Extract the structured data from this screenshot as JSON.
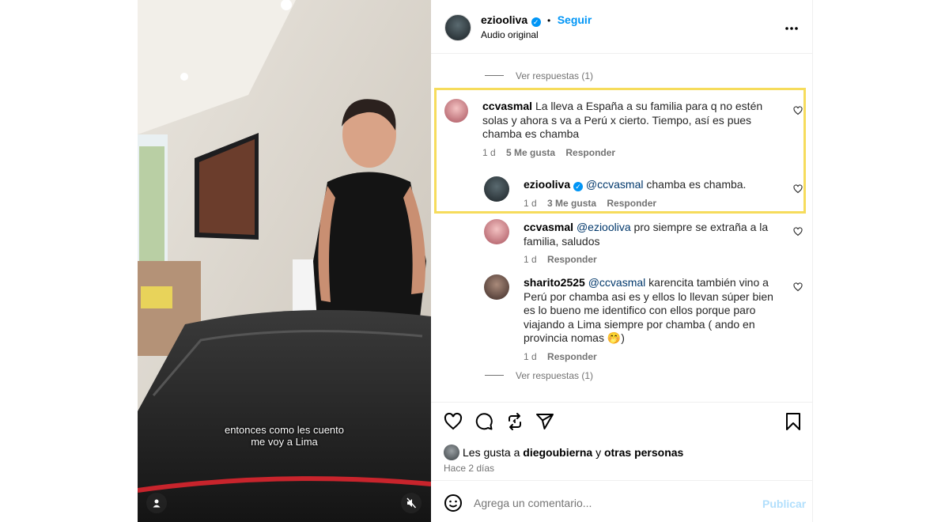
{
  "video": {
    "subtitle_line1": "entonces como les cuento",
    "subtitle_line2": "me voy a Lima",
    "user_icon": "user-icon",
    "mute_icon": "muted-speaker-icon"
  },
  "header": {
    "username": "ezioolivа",
    "dot": "•",
    "follow_label": "Seguir",
    "subtitle": "Audio original",
    "more_icon": "more-icon"
  },
  "thread": {
    "view_replies_top": "Ver respuestas (1)",
    "comment1": {
      "username": "ccvasmal",
      "text": "La lleva a España a su familia para q no estén solas y ahora s va a Perú x cierto. Tiempo, así es pues chamba es chamba",
      "time": "1 d",
      "likes": "5 Me gusta",
      "reply": "Responder"
    },
    "reply1": {
      "username": "ezioolivа",
      "mention": "@ccvasmal",
      "text": "chamba es chamba.",
      "time": "1 d",
      "likes": "3 Me gusta",
      "reply": "Responder"
    },
    "reply2": {
      "username": "ccvasmal",
      "mention": "@ezioolivа",
      "text": "pro siempre se extraña a la familia, saludos",
      "time": "1 d",
      "reply": "Responder"
    },
    "comment2": {
      "username": "sharito2525",
      "mention": "@ccvasmal",
      "text": "karencita también vino a Perú por chamba asi es y ellos lo llevan súper bien es lo bueno me identifico con ellos porque paro viajando a Lima siempre por chamba ( ando en provincia nomas",
      "emoji": "🤭",
      "text_end": ")",
      "time": "1 d",
      "reply": "Responder"
    },
    "view_replies_bottom": "Ver respuestas (1)"
  },
  "actions": {
    "likes_prefix": "Les gusta a",
    "likes_user": "diegoubierna",
    "likes_mid": "y",
    "likes_others": "otras personas",
    "time_ago": "Hace 2 días"
  },
  "composer": {
    "placeholder": "Agrega un comentario...",
    "publish_label": "Publicar"
  },
  "colors": {
    "highlight": "#f6dc5c",
    "link": "#0095f6",
    "mention": "#00376b"
  }
}
